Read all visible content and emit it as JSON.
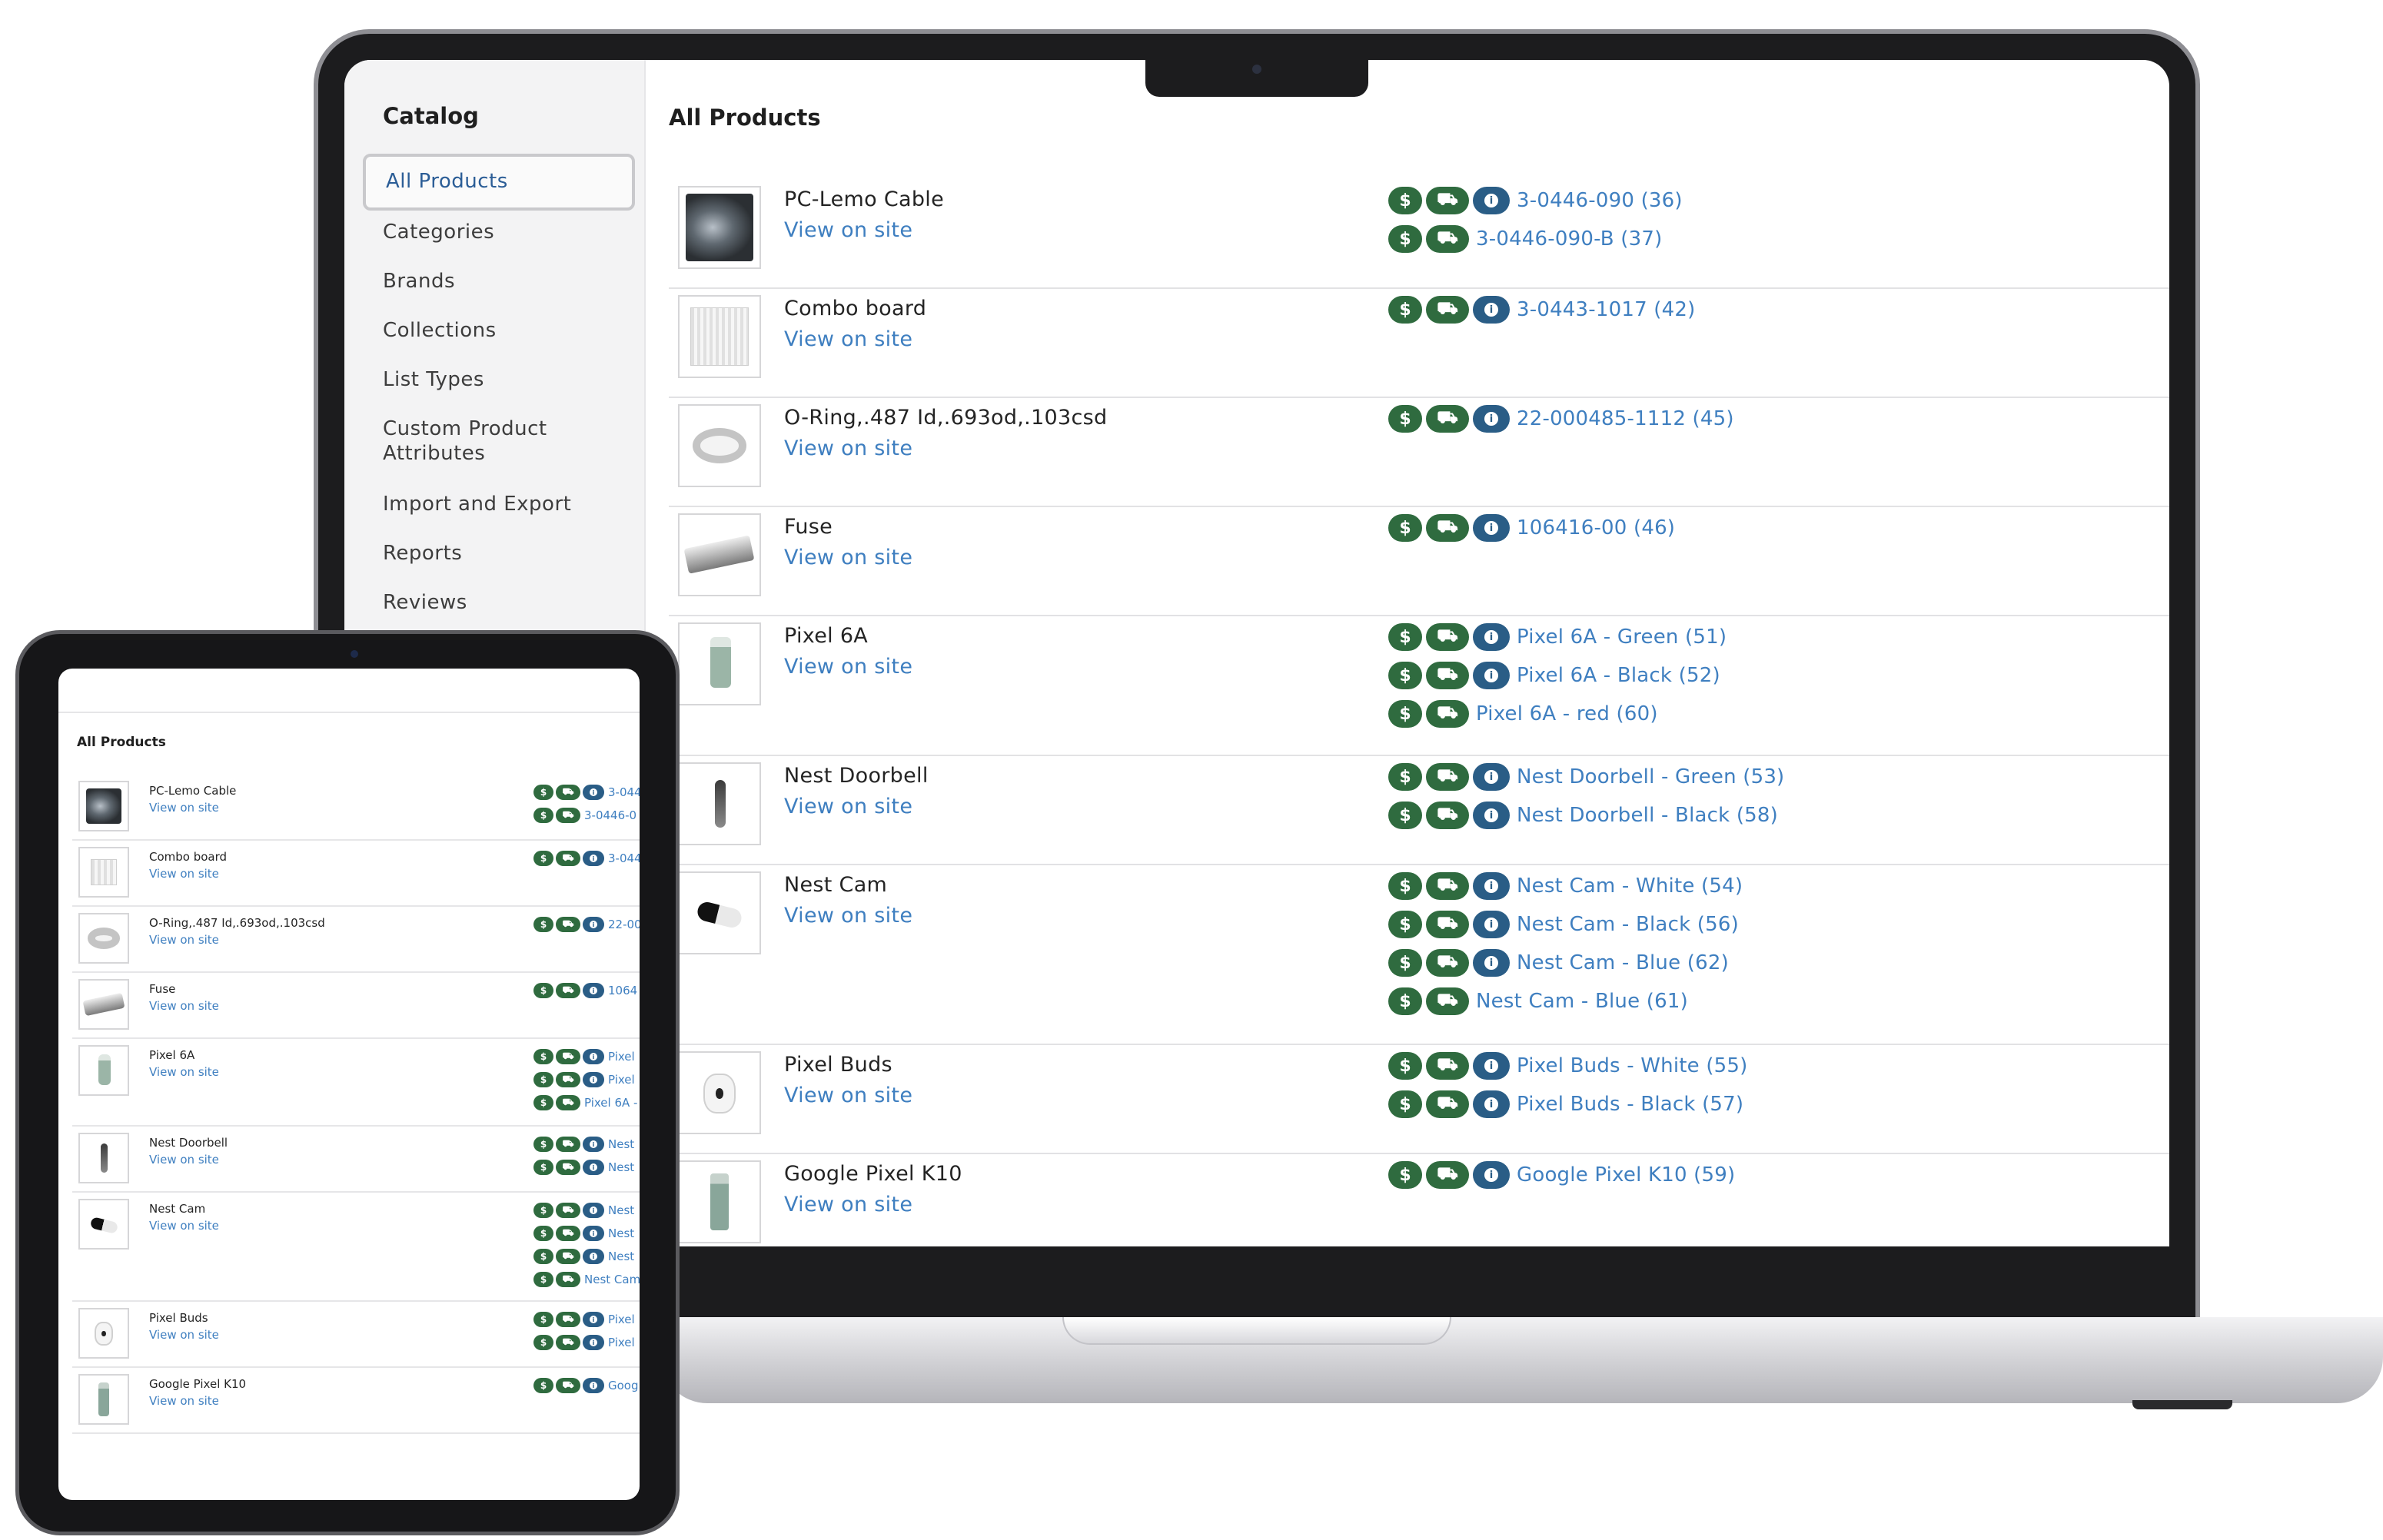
{
  "sidebar": {
    "title": "Catalog",
    "items": [
      {
        "label": "All Products",
        "active": true
      },
      {
        "label": "Categories"
      },
      {
        "label": "Brands"
      },
      {
        "label": "Collections"
      },
      {
        "label": "List Types"
      },
      {
        "label": "Custom Product Attributes"
      },
      {
        "label": "Import and Export"
      },
      {
        "label": "Reports"
      },
      {
        "label": "Reviews"
      }
    ]
  },
  "main": {
    "title": "All Products",
    "view_link": "View on site",
    "products": [
      {
        "name": "PC-Lemo Cable",
        "image": "cable-photo",
        "variants": [
          {
            "text": "3-0446-090 (36)",
            "badges": [
              "dollar",
              "truck",
              "info"
            ]
          },
          {
            "text": "3-0446-090-B (37)",
            "badges": [
              "dollar",
              "truck"
            ]
          }
        ]
      },
      {
        "name": "Combo board",
        "image": "circuit-board-photo",
        "variants": [
          {
            "text": "3-0443-1017 (42)",
            "badges": [
              "dollar",
              "truck",
              "info"
            ]
          }
        ]
      },
      {
        "name": "O-Ring,.487 Id,.693od,.103csd",
        "image": "o-ring-photo",
        "variants": [
          {
            "text": "22-000485-1112 (45)",
            "badges": [
              "dollar",
              "truck",
              "info"
            ]
          }
        ]
      },
      {
        "name": "Fuse",
        "image": "fuse-photo",
        "variants": [
          {
            "text": "106416-00 (46)",
            "badges": [
              "dollar",
              "truck",
              "info"
            ]
          }
        ]
      },
      {
        "name": "Pixel 6A",
        "image": "phone-photo",
        "variants": [
          {
            "text": "Pixel 6A - Green (51)",
            "badges": [
              "dollar",
              "truck",
              "info"
            ]
          },
          {
            "text": "Pixel 6A - Black (52)",
            "badges": [
              "dollar",
              "truck",
              "info"
            ]
          },
          {
            "text": "Pixel 6A - red (60)",
            "badges": [
              "dollar",
              "truck"
            ]
          }
        ]
      },
      {
        "name": "Nest Doorbell",
        "image": "doorbell-photo",
        "variants": [
          {
            "text": "Nest Doorbell - Green (53)",
            "badges": [
              "dollar",
              "truck",
              "info"
            ]
          },
          {
            "text": "Nest Doorbell - Black (58)",
            "badges": [
              "dollar",
              "truck",
              "info"
            ]
          }
        ]
      },
      {
        "name": "Nest Cam",
        "image": "camera-photo",
        "variants": [
          {
            "text": "Nest Cam - White (54)",
            "badges": [
              "dollar",
              "truck",
              "info"
            ]
          },
          {
            "text": "Nest Cam - Black (56)",
            "badges": [
              "dollar",
              "truck",
              "info"
            ]
          },
          {
            "text": "Nest Cam - Blue (62)",
            "badges": [
              "dollar",
              "truck",
              "info"
            ]
          },
          {
            "text": "Nest Cam - Blue (61)",
            "badges": [
              "dollar",
              "truck"
            ]
          }
        ]
      },
      {
        "name": "Pixel Buds",
        "image": "earbuds-photo",
        "variants": [
          {
            "text": "Pixel Buds - White (55)",
            "badges": [
              "dollar",
              "truck",
              "info"
            ]
          },
          {
            "text": "Pixel Buds - Black (57)",
            "badges": [
              "dollar",
              "truck",
              "info"
            ]
          }
        ]
      },
      {
        "name": "Google Pixel K10",
        "image": "phone-photo",
        "variants": [
          {
            "text": "Google Pixel K10 (59)",
            "badges": [
              "dollar",
              "truck",
              "info"
            ]
          }
        ]
      }
    ]
  },
  "badges": {
    "dollar_glyph": "$",
    "info_glyph": "i",
    "truck_glyph": "⛟"
  },
  "tablet": {
    "title": "All Products",
    "view_link": "View on site",
    "variant_texts": [
      [
        "3-044",
        "3-0446-0"
      ],
      [
        "3-044"
      ],
      [
        "22-00"
      ],
      [
        "1064"
      ],
      [
        "Pixel",
        "Pixel",
        "Pixel 6A -"
      ],
      [
        "Nest",
        "Nest"
      ],
      [
        "Nest",
        "Nest",
        "Nest",
        "Nest Cam"
      ],
      [
        "Pixel",
        "Pixel"
      ],
      [
        "Goog"
      ]
    ]
  },
  "colors": {
    "badge_green": "#2f6b3f",
    "badge_blue": "#2a5d86",
    "link_blue": "#3f7fc0"
  }
}
